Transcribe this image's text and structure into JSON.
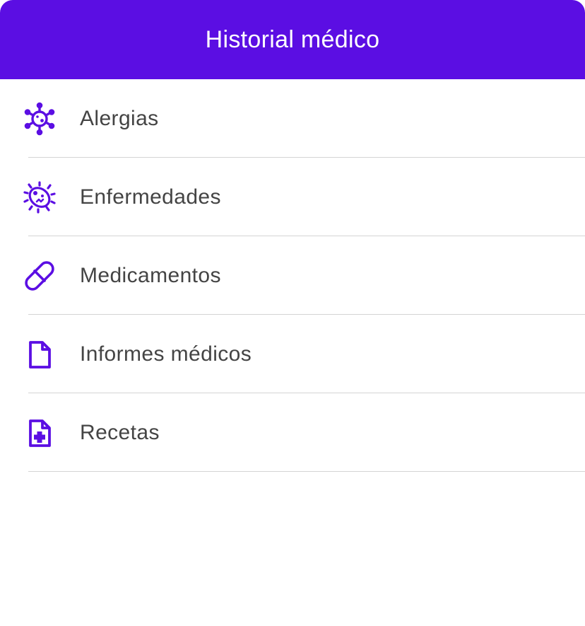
{
  "header": {
    "title": "Historial médico",
    "background_color": "#5b0ee3",
    "title_color": "#ffffff"
  },
  "menu": {
    "accent_color": "#5b0ee3",
    "items": [
      {
        "label": "Alergias",
        "icon": "virus-icon"
      },
      {
        "label": "Enfermedades",
        "icon": "bacteria-icon"
      },
      {
        "label": "Medicamentos",
        "icon": "pill-icon"
      },
      {
        "label": "Informes médicos",
        "icon": "document-icon"
      },
      {
        "label": "Recetas",
        "icon": "prescription-document-icon"
      }
    ]
  }
}
